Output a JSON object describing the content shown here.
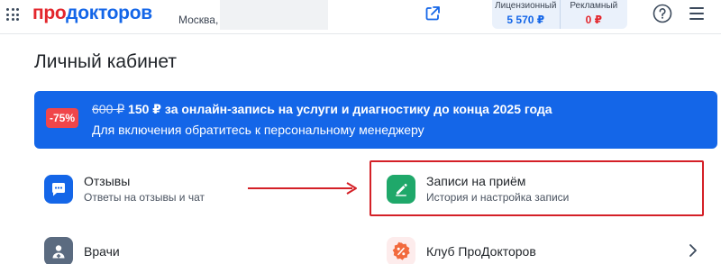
{
  "header": {
    "logo_part1": "про",
    "logo_part2": "докторов",
    "city": "Москва,",
    "balances": [
      {
        "label": "Лицензионный",
        "value": "5 570 ₽"
      },
      {
        "label": "Рекламный",
        "value": "0 ₽"
      }
    ]
  },
  "page": {
    "title": "Личный кабинет"
  },
  "promo": {
    "badge": "-75%",
    "old_price": "600 ₽",
    "headline": " 150 ₽ за онлайн-запись на услуги и диагностику до конца 2025 года",
    "subline": "Для включения обратитесь к персональному менеджеру"
  },
  "cards": {
    "reviews": {
      "title": "Отзывы",
      "subtitle": "Ответы на отзывы и чат"
    },
    "appointments": {
      "title": "Записи на приём",
      "subtitle": "История и настройка записи"
    },
    "doctors": {
      "title": "Врачи"
    },
    "club": {
      "title": "Клуб ПроДокторов"
    }
  },
  "colors": {
    "brand_blue": "#1466e8",
    "brand_red": "#e3262c",
    "badge_red": "#f0464a",
    "green": "#1fa86a",
    "annotation_red": "#d42027"
  }
}
